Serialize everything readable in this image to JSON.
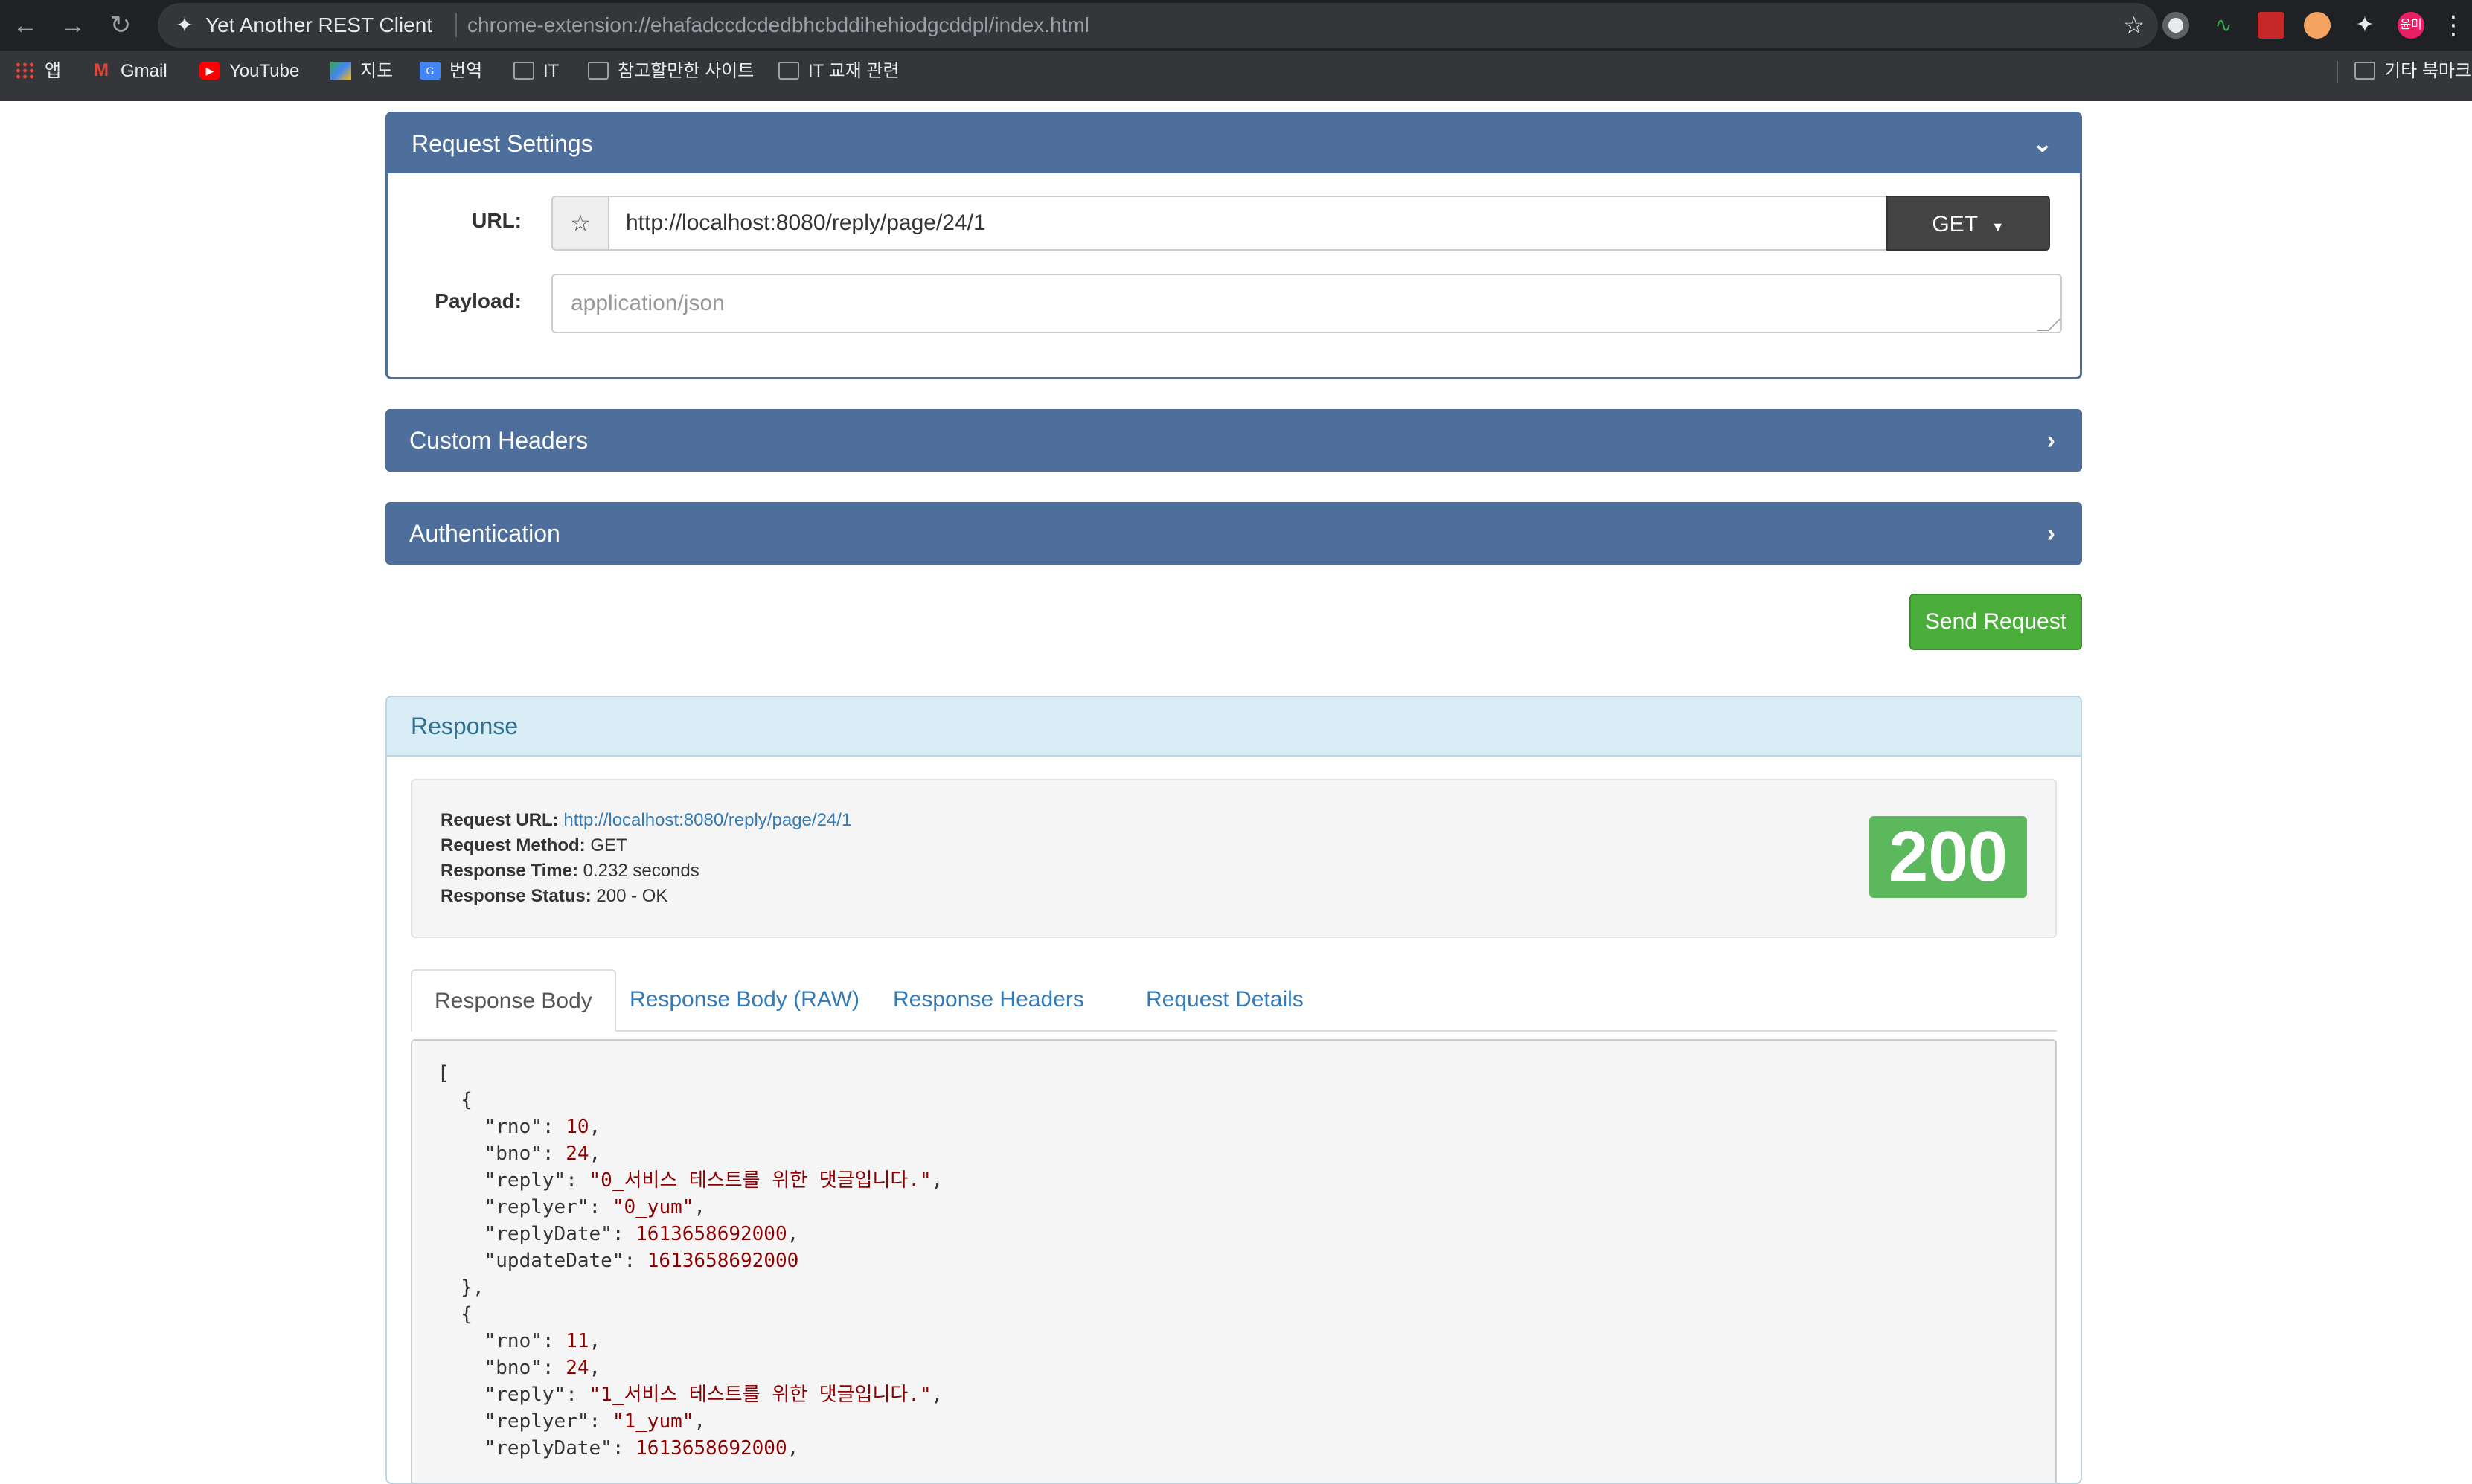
{
  "browser": {
    "tab_title": "Yet Another REST Client",
    "address_url": "chrome-extension://ehafadccdcdedbhcbddihehiodgcddpl/index.html",
    "bookmarks": [
      "앱",
      "Gmail",
      "YouTube",
      "지도",
      "번역",
      "IT",
      "참고할만한 사이트",
      "IT 교재 관련"
    ],
    "other_bookmarks": "기타 북마크",
    "profile_initials": "윤미"
  },
  "request_settings": {
    "title": "Request Settings",
    "url_label": "URL:",
    "url_value": "http://localhost:8080/reply/page/24/1",
    "method": "GET",
    "payload_label": "Payload:",
    "payload_placeholder": "application/json"
  },
  "custom_headers": {
    "title": "Custom Headers"
  },
  "authentication": {
    "title": "Authentication"
  },
  "send_button": "Send Request",
  "response": {
    "title": "Response",
    "request_url_label": "Request URL:",
    "request_url": "http://localhost:8080/reply/page/24/1",
    "request_method_label": "Request Method:",
    "request_method": "GET",
    "response_time_label": "Response Time:",
    "response_time": "0.232 seconds",
    "response_status_label": "Response Status:",
    "response_status": "200 - OK",
    "status_code": "200",
    "tabs": [
      "Response Body",
      "Response Body (RAW)",
      "Response Headers",
      "Request Details"
    ],
    "body_items": [
      {
        "rno": 10,
        "bno": 24,
        "reply": "0_서비스 테스트를 위한 댓글입니다.",
        "replyer": "0_yum",
        "replyDate": 1613658692000,
        "updateDate": 1613658692000
      },
      {
        "rno": 11,
        "bno": 24,
        "reply": "1_서비스 테스트를 위한 댓글입니다.",
        "replyer": "1_yum",
        "replyDate": 1613658692000
      }
    ]
  },
  "colors": {
    "panel_header": "#4e6f9b",
    "send_button": "#4cae3a",
    "status_badge": "#5cb85c",
    "response_header_bg": "#d9edf7",
    "json_value": "#8b0000"
  }
}
